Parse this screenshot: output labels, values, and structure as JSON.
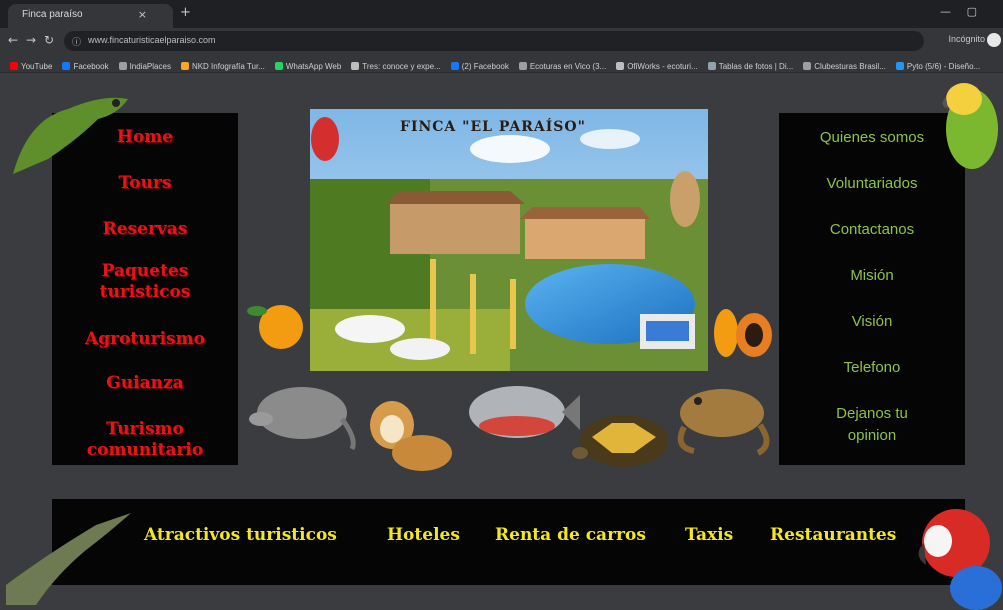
{
  "browser": {
    "tab_title": "Finca paraíso",
    "tab_close": "×",
    "new_tab": "+",
    "url": "www.fincaturisticaelparaiso.com",
    "incognito_label": "Incógnito",
    "bookmarks": [
      {
        "label": "YouTube",
        "color": "#ff0000"
      },
      {
        "label": "Facebook",
        "color": "#1877f2"
      },
      {
        "label": "IndiaPlaces",
        "color": "#9e9e9e"
      },
      {
        "label": "NKD Infografía Tur...",
        "color": "#f9a825"
      },
      {
        "label": "WhatsApp Web",
        "color": "#25d366"
      },
      {
        "label": "Tres: conoce y expe...",
        "color": "#bdbdbd"
      },
      {
        "label": "(2) Facebook",
        "color": "#1877f2"
      },
      {
        "label": "Ecoturas en Vico (3...",
        "color": "#9e9e9e"
      },
      {
        "label": "OfiWorks - ecoturi...",
        "color": "#bdbdbd"
      },
      {
        "label": "Tablas de fotos | Di...",
        "color": "#90a4ae"
      },
      {
        "label": "Clubesturas Brasil...",
        "color": "#9e9e9e"
      },
      {
        "label": "Pyto (5/6) - Diseño...",
        "color": "#2196f3"
      }
    ]
  },
  "site": {
    "hero_title": "FINCA \"EL PARAÍSO\"",
    "left_nav": [
      "Home",
      "Tours",
      "Reservas",
      "Paquetes turisticos",
      "Agroturismo",
      "Guianza",
      "Turismo comunitario"
    ],
    "right_nav": [
      "Quienes somos",
      "Voluntariados",
      "Contactanos",
      "Misión",
      "Visión",
      "Telefono",
      "Dejanos tu opinion"
    ],
    "bottom_nav": [
      "Atractivos turisticos",
      "Hoteles",
      "Renta de carros",
      "Taxis",
      "Restaurantes"
    ]
  },
  "colors": {
    "page_bg": "#3a3c3f",
    "panel_bg": "#050505",
    "left_nav_text": "#e4141b",
    "right_nav_text": "#8bc34a",
    "bottom_nav_text": "#f2e81d"
  },
  "images": [
    "iguana",
    "parrot",
    "orange",
    "papaya",
    "armadillo",
    "monkey",
    "piranha",
    "tortoise",
    "toad",
    "crocodile",
    "macaw"
  ]
}
